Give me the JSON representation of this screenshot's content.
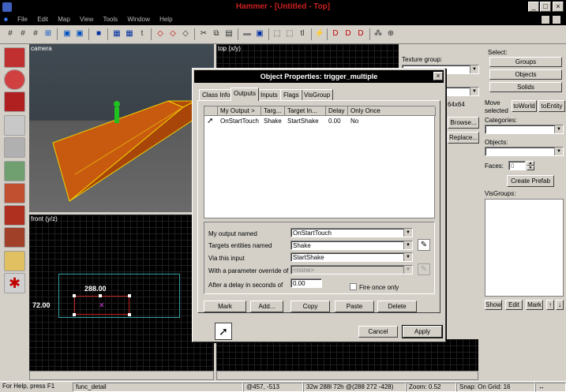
{
  "window": {
    "title": "Hammer - [Untitled - Top]"
  },
  "menu": [
    "File",
    "Edit",
    "Map",
    "View",
    "Tools",
    "Window",
    "Help"
  ],
  "viewports": {
    "camera": "camera",
    "top": "top (x/y)",
    "front": "front (y/z)",
    "dim_width": "288.00",
    "dim_height": "72.00"
  },
  "texture_panel": {
    "group_label": "Texture group:",
    "size": "64x64",
    "browse": "Browse...",
    "replace": "Replace..."
  },
  "right": {
    "select_label": "Select:",
    "groups": "Groups",
    "objects": "Objects",
    "solids": "Solids",
    "move_selected": "Move selected",
    "to_world": "toWorld",
    "to_entity": "toEntity",
    "categories_label": "Categories:",
    "objects_label": "Objects:",
    "faces_label": "Faces:",
    "faces_value": "0",
    "create_prefab": "Create Prefab",
    "visgroups_label": "VisGroups:",
    "show": "Show",
    "edit": "Edit",
    "mark": "Mark",
    "up": "↑",
    "down": "↓"
  },
  "dialog": {
    "title": "Object Properties: trigger_multiple",
    "tabs": [
      "Class Info",
      "Outputs",
      "Inputs",
      "Flags",
      "VisGroup"
    ],
    "columns": [
      "My Output >",
      "Targ...",
      "Target In...",
      "Delay",
      "Only Once"
    ],
    "rows": [
      {
        "output": "OnStartTouch",
        "target": "Shake",
        "input": "StartShake",
        "delay": "0.00",
        "once": "No"
      }
    ],
    "form": {
      "output_label": "My output named",
      "output_value": "OnStartTouch",
      "target_label": "Targets entities named",
      "target_value": "Shake",
      "input_label": "Via this input",
      "input_value": "StartShake",
      "param_label": "With a parameter override of",
      "param_value": "<none>",
      "delay_label": "After a delay in seconds of",
      "delay_value": "0.00",
      "fire_once": "Fire once only"
    },
    "buttons": {
      "mark": "Mark",
      "add": "Add...",
      "copy": "Copy",
      "paste": "Paste",
      "delete": "Delete"
    },
    "cancel": "Cancel",
    "apply": "Apply"
  },
  "status": {
    "help": "For Help, press F1",
    "object": "func_detail",
    "coords": "@457, -513",
    "size": "32w 288l 72h @(288 272 -428)",
    "zoom": "Zoom: 0.52",
    "snap": "Snap: On Grid: 16"
  },
  "colors": {
    "accent_title": "#c92020",
    "selection": "#e06010",
    "dialog_title_bg": "#000000"
  }
}
